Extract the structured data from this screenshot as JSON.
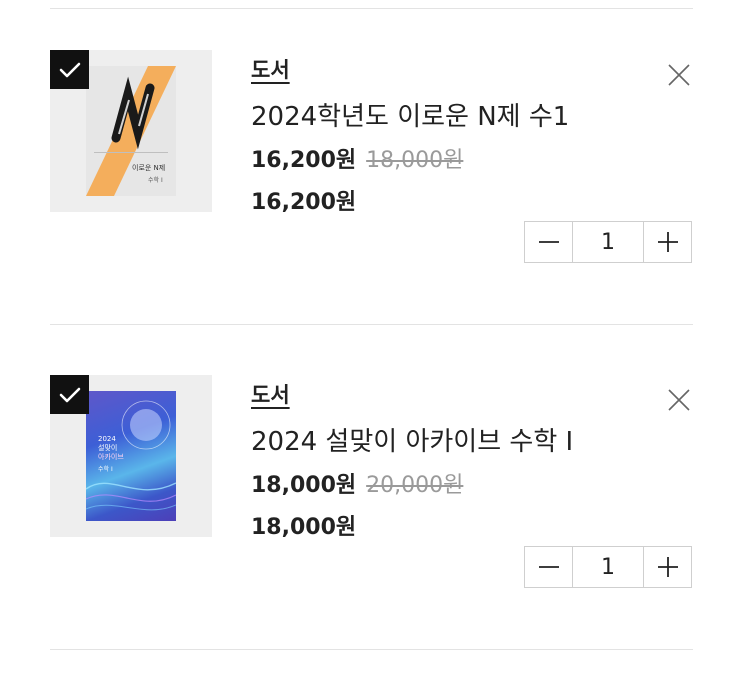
{
  "cart": {
    "items": [
      {
        "category": "도서",
        "title": "2024학년도 이로운 N제 수1",
        "sale_price": "16,200원",
        "original_price": "18,000원",
        "total_price": "16,200원",
        "quantity": "1",
        "checked": true,
        "cover": {
          "title": "이로운 N제",
          "subtitle": "수학 I",
          "accent_color": "#f4ae5c"
        }
      },
      {
        "category": "도서",
        "title": "2024 설맞이 아카이브 수학 I",
        "sale_price": "18,000원",
        "original_price": "20,000원",
        "total_price": "18,000원",
        "quantity": "1",
        "checked": true,
        "cover": {
          "year": "2024",
          "title_line1": "설맞이",
          "title_line2": "아카이브",
          "subtitle": "수학 I",
          "accent_color": "#4d63d6"
        }
      }
    ]
  },
  "icons": {
    "check": "checkmark-icon",
    "remove": "close-icon",
    "minus": "minus-icon",
    "plus": "plus-icon"
  },
  "colors": {
    "checkbox_bg": "#111111",
    "old_price": "#9a9a9a",
    "divider": "#e3e3e3"
  }
}
